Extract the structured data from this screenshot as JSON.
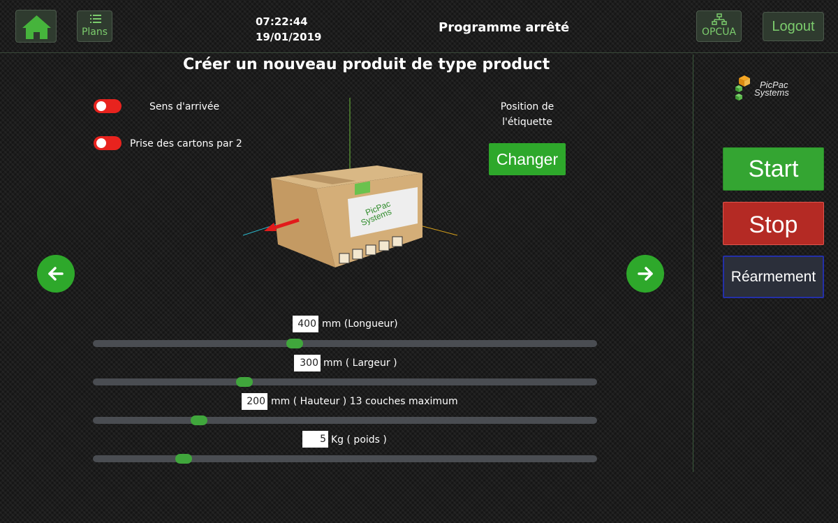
{
  "header": {
    "time": "07:22:44",
    "date": "19/01/2019",
    "status": "Programme arrêté",
    "plans_label": "Plans",
    "opcua_label": "OPCUA",
    "logout_label": "Logout"
  },
  "main": {
    "title": "Créer un nouveau produit de type product",
    "toggles": [
      {
        "label": "Sens d'arrivée",
        "on": false
      },
      {
        "label": "Prise des cartons par 2",
        "on": false
      }
    ],
    "label_position": {
      "line1": "Position de",
      "line2": "l'étiquette"
    },
    "changer_label": "Changer",
    "box_label": {
      "line1": "PicPac",
      "line2": "Systems"
    },
    "sliders": [
      {
        "value": "400",
        "label": "mm (Longueur)",
        "fraction": 0.4
      },
      {
        "value": "300",
        "label": "mm ( Largeur )",
        "fraction": 0.3
      },
      {
        "value": "200",
        "label": "mm ( Hauteur ) 13 couches maximum",
        "fraction": 0.21
      },
      {
        "value": "5",
        "label": "Kg ( poids )",
        "fraction": 0.18
      }
    ]
  },
  "sidebar": {
    "logo": {
      "line1": "PicPac",
      "line2": "Systems"
    },
    "start_label": "Start",
    "stop_label": "Stop",
    "rearm_label": "Réarmement"
  },
  "colors": {
    "accent_green": "#2ea82b",
    "stop_red": "#b42a24",
    "toggle_off_red": "#e8231e",
    "text_green": "#7ccd6d"
  },
  "icons": [
    "home-icon",
    "list-icon",
    "network-icon",
    "arrow-left-icon",
    "arrow-right-icon",
    "picpac-logo-icon"
  ]
}
